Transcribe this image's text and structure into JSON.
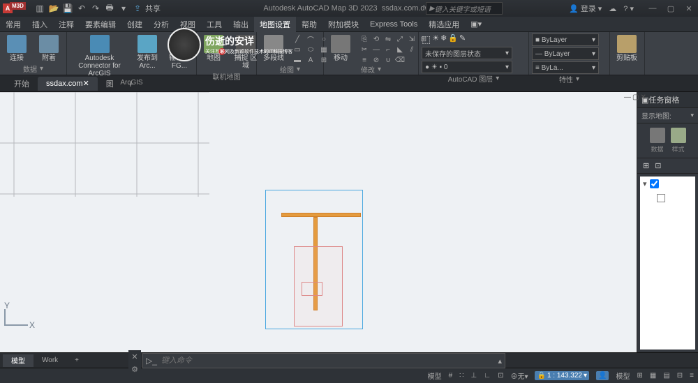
{
  "titlebar": {
    "app_letter": "A",
    "m3d": "M3D",
    "share": "共享",
    "title_app": "Autodesk AutoCAD Map 3D 2023",
    "title_file": "ssdax.com.dwg",
    "search_placeholder": "键入关键字或短语",
    "login": "登录"
  },
  "menutabs": [
    "常用",
    "插入",
    "注释",
    "要素编辑",
    "创建",
    "分析",
    "视图",
    "工具",
    "输出",
    "地图设置",
    "帮助",
    "附加模块",
    "Express Tools",
    "精选应用"
  ],
  "menutab_active": 9,
  "ribbon": {
    "panels": [
      {
        "label": "数据",
        "btns": [
          {
            "t": "连接"
          },
          {
            "t": "附着"
          }
        ]
      },
      {
        "label": "ArcGIS",
        "btns": [
          {
            "t": "Autodesk Connector\nfor ArcGIS"
          },
          {
            "t": "发布到 Arc..."
          },
          {
            "t": "输出到 FG..."
          }
        ]
      },
      {
        "label": "联机地图",
        "btns": [
          {
            "t": "地图"
          },
          {
            "t": "捕捉\n区域"
          }
        ]
      },
      {
        "label": "绘图",
        "btns": [
          {
            "t": "多段线"
          }
        ]
      },
      {
        "label": "修改",
        "btns": [
          {
            "t": "移动"
          }
        ]
      },
      {
        "label": "AutoCAD 图层",
        "combo": "未保存的图层状态"
      },
      {
        "label": "特性",
        "combos": [
          "ByLayer",
          "ByLayer",
          "ByLa..."
        ]
      },
      {
        "label": "剪贴板",
        "btns": [
          {
            "t": "剪贴板"
          }
        ]
      }
    ]
  },
  "filetabs": {
    "items": [
      "开始",
      "ssdax.com",
      "图"
    ],
    "active": 1
  },
  "taskpane": {
    "title": "任务窗格",
    "sub": "显示地图:",
    "tool1": "数据",
    "tool2": "样式"
  },
  "cmdline_placeholder": "键入命令",
  "modeltabs": {
    "items": [
      "模型",
      "Work"
    ],
    "active": 0
  },
  "status": {
    "items": [
      "模型",
      "#",
      "∷",
      "⊥",
      "∟",
      "☰",
      "⊕",
      "⊡",
      "⊗",
      "▤",
      "≡"
    ],
    "scale": "1 : 143.322",
    "model": "模型",
    "grid_icons": [
      "⊞",
      "⊟",
      "▦",
      "▤"
    ]
  },
  "watermark": "伤逝的安详"
}
